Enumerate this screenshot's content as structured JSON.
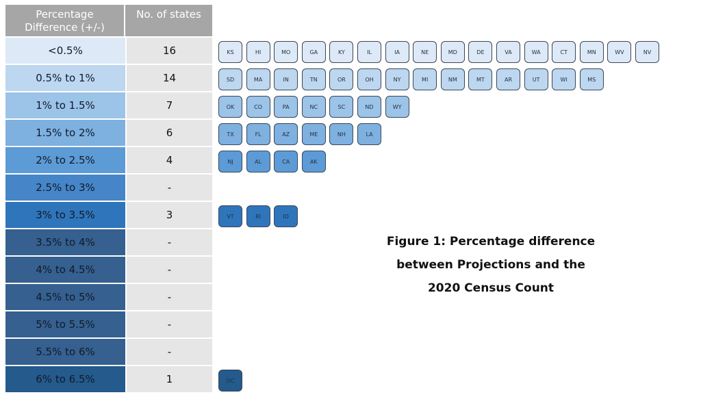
{
  "table": {
    "headers": [
      "Percentage\nDifference  (+/-)",
      "No. of states"
    ],
    "rows": [
      {
        "range": "<0.5%",
        "count": "16",
        "color": "#dde9f6"
      },
      {
        "range": "0.5% to 1%",
        "count": "14",
        "color": "#bcd7ef"
      },
      {
        "range": "1% to 1.5%",
        "count": "7",
        "color": "#9cc3e8"
      },
      {
        "range": "1.5% to 2%",
        "count": "6",
        "color": "#7eb0e0"
      },
      {
        "range": "2% to 2.5%",
        "count": "4",
        "color": "#5c9bd6"
      },
      {
        "range": "2.5% to 3%",
        "count": "-",
        "color": "#4585c8"
      },
      {
        "range": "3% to 3.5%",
        "count": "3",
        "color": "#2f75bb"
      },
      {
        "range": "3.5% to 4%",
        "count": "-",
        "color": "#35608f"
      },
      {
        "range": "4% to 4.5%",
        "count": "-",
        "color": "#35608f"
      },
      {
        "range": "4.5% to 5%",
        "count": "-",
        "color": "#35608f"
      },
      {
        "range": "5% to 5.5%",
        "count": "-",
        "color": "#35608f"
      },
      {
        "range": "5.5% to 6%",
        "count": "-",
        "color": "#35608f"
      },
      {
        "range": "6% to 6.5%",
        "count": "1",
        "color": "#245a8c"
      }
    ]
  },
  "tiles": [
    {
      "color": "#dde9f6",
      "states": [
        "KS",
        "HI",
        "MO",
        "GA",
        "KY",
        "IL",
        "IA",
        "NE",
        "MD",
        "DE",
        "VA",
        "WA",
        "CT",
        "MN",
        "WV",
        "NV"
      ]
    },
    {
      "color": "#bcd7ef",
      "states": [
        "SD",
        "MA",
        "IN",
        "TN",
        "OR",
        "OH",
        "NY",
        "MI",
        "NM",
        "MT",
        "AR",
        "UT",
        "WI",
        "MS"
      ]
    },
    {
      "color": "#9cc3e8",
      "states": [
        "OK",
        "CO",
        "PA",
        "NC",
        "SC",
        "ND",
        "WY"
      ]
    },
    {
      "color": "#7eb0e0",
      "states": [
        "TX",
        "FL",
        "AZ",
        "ME",
        "NH",
        "LA"
      ]
    },
    {
      "color": "#5c9bd6",
      "states": [
        "NJ",
        "AL",
        "CA",
        "AK"
      ]
    },
    {
      "color": "#4585c8",
      "states": []
    },
    {
      "color": "#2f75bb",
      "states": [
        "VT",
        "RI",
        "ID"
      ]
    },
    {
      "color": "#35608f",
      "states": []
    },
    {
      "color": "#35608f",
      "states": []
    },
    {
      "color": "#35608f",
      "states": []
    },
    {
      "color": "#35608f",
      "states": []
    },
    {
      "color": "#35608f",
      "states": []
    },
    {
      "color": "#245a8c",
      "states": [
        "DC"
      ]
    }
  ],
  "caption": "Figure 1: Percentage difference\nbetween Projections and the\n2020 Census Count",
  "chart_data": {
    "type": "table",
    "title": "Figure 1: Percentage difference between Projections and the 2020 Census Count",
    "columns": [
      "Percentage Difference (+/-)",
      "No. of states"
    ],
    "categories": [
      "<0.5%",
      "0.5% to 1%",
      "1% to 1.5%",
      "1.5% to 2%",
      "2% to 2.5%",
      "2.5% to 3%",
      "3% to 3.5%",
      "3.5% to 4%",
      "4% to 4.5%",
      "4.5% to 5%",
      "5% to 5.5%",
      "5.5% to 6%",
      "6% to 6.5%"
    ],
    "values": [
      16,
      14,
      7,
      6,
      4,
      0,
      3,
      0,
      0,
      0,
      0,
      0,
      1
    ],
    "states_by_category": [
      [
        "KS",
        "HI",
        "MO",
        "GA",
        "KY",
        "IL",
        "IA",
        "NE",
        "MD",
        "DE",
        "VA",
        "WA",
        "CT",
        "MN",
        "WV",
        "NV"
      ],
      [
        "SD",
        "MA",
        "IN",
        "TN",
        "OR",
        "OH",
        "NY",
        "MI",
        "NM",
        "MT",
        "AR",
        "UT",
        "WI",
        "MS"
      ],
      [
        "OK",
        "CO",
        "PA",
        "NC",
        "SC",
        "ND",
        "WY"
      ],
      [
        "TX",
        "FL",
        "AZ",
        "ME",
        "NH",
        "LA"
      ],
      [
        "NJ",
        "AL",
        "CA",
        "AK"
      ],
      [],
      [
        "VT",
        "RI",
        "ID"
      ],
      [],
      [],
      [],
      [],
      [],
      [
        "DC"
      ]
    ]
  }
}
